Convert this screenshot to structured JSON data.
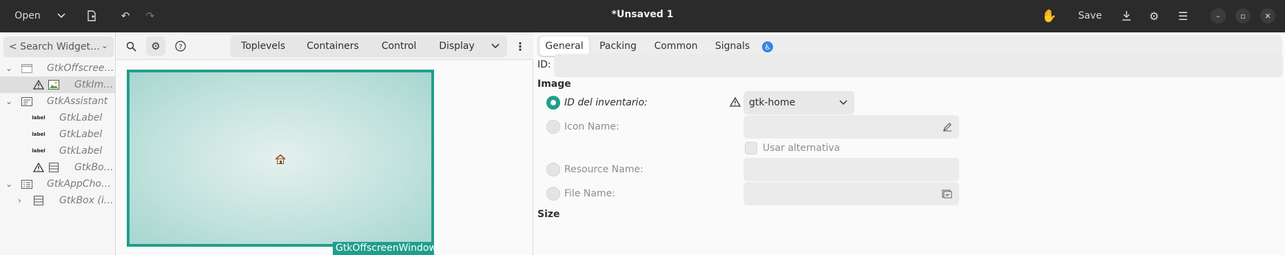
{
  "header": {
    "open_label": "Open",
    "title": "*Unsaved 1",
    "save_label": "Save"
  },
  "left": {
    "search_placeholder": "< Search Widget…",
    "tree": [
      {
        "label": "GtkOffscree…",
        "icon": "window-icon",
        "expanded": true
      },
      {
        "label": "GtkIm…",
        "icon": "image-icon",
        "warning": true,
        "selected": true
      },
      {
        "label": "GtkAssistant",
        "icon": "assistant-icon",
        "expanded": true
      },
      {
        "label": "GtkLabel",
        "icon": "label-icon",
        "icon_text": "label"
      },
      {
        "label": "GtkLabel",
        "icon": "label-icon",
        "icon_text": "label"
      },
      {
        "label": "GtkLabel",
        "icon": "label-icon",
        "icon_text": "label"
      },
      {
        "label": "GtkBo…",
        "icon": "box-icon",
        "warning": true
      },
      {
        "label": "GtkAppCho…",
        "icon": "app-chooser-icon",
        "expanded": true
      },
      {
        "label": "GtkBox  (i…",
        "icon": "box-icon",
        "expanded": false
      }
    ]
  },
  "mid": {
    "groups": [
      "Toplevels",
      "Containers",
      "Control",
      "Display"
    ],
    "canvas_label": "GtkOffscreenWindow"
  },
  "right": {
    "tabs": [
      "General",
      "Packing",
      "Common",
      "Signals"
    ],
    "id_label": "ID:",
    "section_image": "Image",
    "stock_label": "ID del inventario:",
    "stock_value": "gtk-home",
    "icon_name_label": "Icon Name:",
    "use_fallback_label": "Usar alternativa",
    "resource_label": "Resource Name:",
    "file_label": "File Name:",
    "section_size": "Size"
  }
}
